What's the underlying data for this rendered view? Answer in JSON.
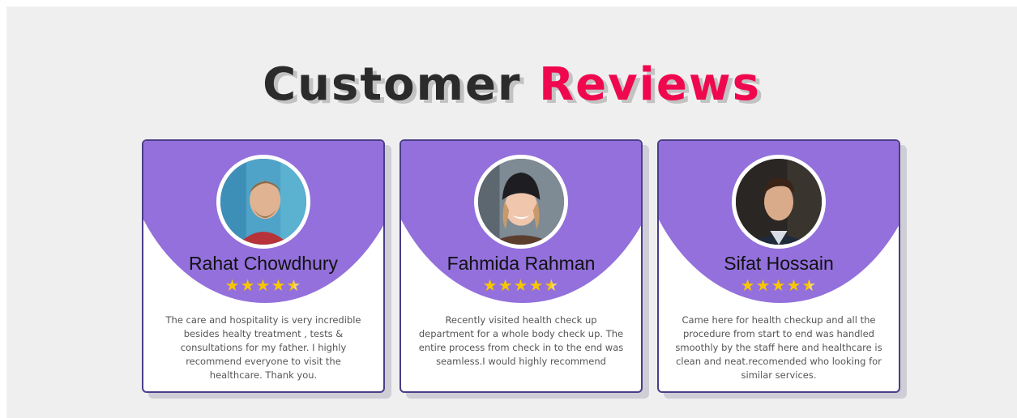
{
  "heading": {
    "part1": "Customer",
    "part2": "Reviews"
  },
  "colors": {
    "accent": "#f0084f",
    "card_top": "#9370db",
    "star": "#f7c600",
    "border": "#4a3e88"
  },
  "reviews": [
    {
      "name": "Rahat Chowdhury",
      "rating": 4.5,
      "text": "The care and hospitality is very incredible besides healty treatment , tests & consultations for my father. I highly recommend everyone to visit the healthcare. Thank you."
    },
    {
      "name": "Fahmida Rahman",
      "rating": 4.5,
      "text": "Recently visited health check up department for a whole body check up. The entire process from check in to the end was seamless.I would highly recommend"
    },
    {
      "name": "Sifat Hossain",
      "rating": 4.5,
      "text": "Came here for health checkup and all the procedure from start to end was handled smoothly by the staff here and healthcare is clean and neat.recomended who looking for similar services."
    }
  ],
  "icons": {
    "star": "star-icon",
    "half_star": "half-star-icon",
    "avatar": "avatar-photo"
  }
}
